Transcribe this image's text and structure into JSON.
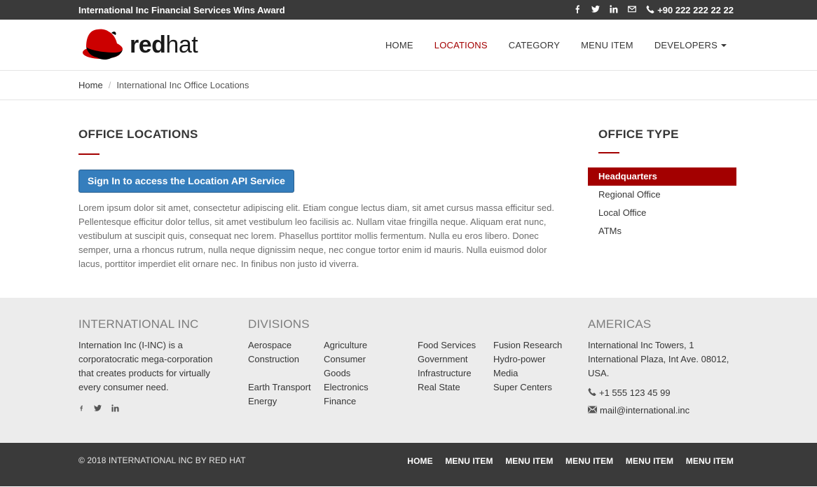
{
  "topbar": {
    "announcement": "International Inc Financial Services Wins Award",
    "social_icons": [
      "facebook-icon",
      "twitter-icon",
      "linkedin-icon",
      "envelope-icon"
    ],
    "phone": "+90 222 222 22 22"
  },
  "header": {
    "logo_text_bold": "red",
    "logo_text_light": "hat",
    "nav": [
      {
        "label": "HOME"
      },
      {
        "label": "LOCATIONS",
        "active": true
      },
      {
        "label": "CATEGORY"
      },
      {
        "label": "MENU ITEM"
      },
      {
        "label": "DEVELOPERS",
        "dropdown": true
      }
    ]
  },
  "breadcrumb": {
    "home": "Home",
    "current": "International Inc Office Locations"
  },
  "main": {
    "title": "OFFICE LOCATIONS",
    "button_label": "Sign In to access the Location API Service",
    "body": "Lorem ipsum dolor sit amet, consectetur adipiscing elit. Etiam congue lectus diam, sit amet cursus massa efficitur sed. Pellentesque efficitur dolor tellus, sit amet vestibulum leo facilisis ac. Nullam vitae fringilla neque. Aliquam erat nunc, vestibulum at suscipit quis, consequat nec lorem. Phasellus porttitor mollis fermentum. Nulla eu eros libero. Donec semper, urna a rhoncus rutrum, nulla neque dignissim neque, nec congue tortor enim id mauris. Nulla euismod dolor lacus, porttitor imperdiet elit ornare nec. In finibus non justo id viverra."
  },
  "sidebar": {
    "title": "OFFICE TYPE",
    "items": [
      {
        "label": "Headquarters",
        "active": true
      },
      {
        "label": "Regional Office"
      },
      {
        "label": "Local Office"
      },
      {
        "label": "ATMs"
      }
    ]
  },
  "footer": {
    "company": {
      "title": "INTERNATIONAL INC",
      "text": "Internation Inc (I-INC) is a corporatocratic mega-corporation that creates products for virtually every consumer need."
    },
    "divisions": {
      "title": "DIVISIONS",
      "col1": [
        "Aerospace",
        "Construction",
        "",
        "Earth Transport",
        "Energy"
      ],
      "col2": [
        "Agriculture",
        "Consumer",
        "Goods",
        "Electronics",
        "Finance"
      ],
      "col3": [
        "Food Services",
        "Government",
        "Infrastructure",
        "Real State"
      ],
      "col4": [
        "Fusion Research",
        "Hydro-power",
        "Media",
        "Super Centers"
      ]
    },
    "americas": {
      "title": "AMERICAS",
      "address": "International Inc Towers, 1 International Plaza, Int Ave. 08012, USA.",
      "phone": "+1 555 123 45 99",
      "email": "mail@international.inc"
    }
  },
  "bottombar": {
    "copyright": "© 2018 INTERNATIONAL INC BY RED HAT",
    "links": [
      "HOME",
      "MENU ITEM",
      "MENU ITEM",
      "MENU ITEM",
      "MENU ITEM",
      "MENU ITEM"
    ]
  },
  "colors": {
    "brand_red": "#a30000",
    "button_blue": "#357ebd",
    "dark_bar": "#3a3a3a",
    "footer_bg": "#ececec"
  }
}
